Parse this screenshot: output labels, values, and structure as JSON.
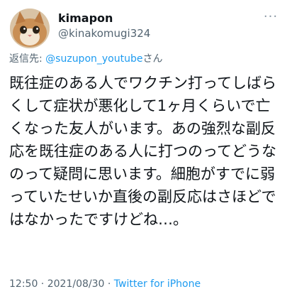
{
  "user": {
    "display_name": "kimapon",
    "handle": "@kinakomugi324"
  },
  "reply": {
    "prefix": "返信先: ",
    "mention": "@suzupon_youtube",
    "suffix": "さん"
  },
  "tweet": {
    "text": "既往症のある人でワクチン打ってしばらくして症状が悪化して1ヶ月くらいで亡くなった友人がいます。あの強烈な副反応を既往症のある人に打つのってどうなのって疑問に思います。細胞がすでに弱っていたせいか直後の副反応はさほどではなかったですけどね…。"
  },
  "meta": {
    "time": "12:50",
    "separator1": " · ",
    "date": "2021/08/30",
    "separator2": " · ",
    "source": "Twitter for iPhone"
  },
  "more_glyph": "···",
  "colors": {
    "link": "#1d9bf0",
    "secondary_text": "#536471"
  }
}
